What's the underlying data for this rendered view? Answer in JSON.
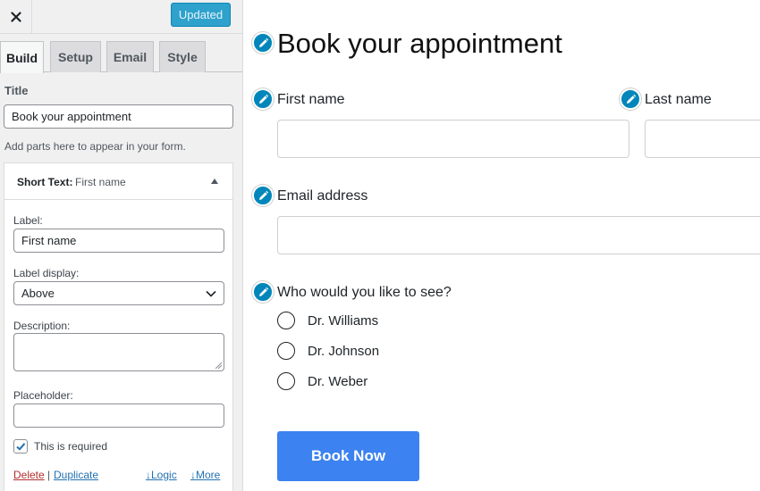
{
  "customizer": {
    "close_icon": "close-icon",
    "updated_label": "Updated",
    "tabs": [
      {
        "label": "Build",
        "active": true
      },
      {
        "label": "Setup",
        "active": false
      },
      {
        "label": "Email",
        "active": false
      },
      {
        "label": "Style",
        "active": false
      }
    ],
    "title_label": "Title",
    "title_value": "Book your appointment",
    "hint": "Add parts here to appear in your form.",
    "field_card": {
      "type_label": "Short Text:",
      "field_name": "First name",
      "collapse_icon": "triangle-up-icon",
      "label_label": "Label:",
      "label_value": "First name",
      "label_display_label": "Label display:",
      "label_display_value": "Above",
      "description_label": "Description:",
      "description_value": "",
      "placeholder_label": "Placeholder:",
      "placeholder_value": "",
      "required_label": "This is required",
      "required_checked": true,
      "delete_label": "Delete",
      "separator": "|",
      "duplicate_label": "Duplicate",
      "logic_label": "↓Logic",
      "more_label": "↓More"
    }
  },
  "form_preview": {
    "edit_icon": "pencil-icon",
    "title": "Book your appointment",
    "fields": {
      "first_name_label": "First name",
      "last_name_label": "Last name",
      "email_label": "Email address",
      "who_label": "Who would you like to see?"
    },
    "options": [
      "Dr. Williams",
      "Dr. Johnson",
      "Dr. Weber"
    ],
    "submit_label": "Book Now"
  },
  "colors": {
    "accent_blue": "#2ea2cc",
    "edit_dot": "#0086ba",
    "submit_button": "#3c82f0",
    "delete_link": "#b32d2e",
    "link": "#2271b1"
  }
}
